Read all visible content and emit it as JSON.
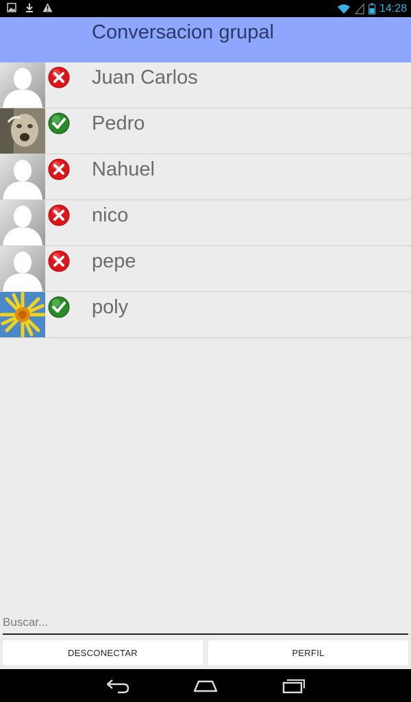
{
  "status_bar": {
    "time": "14:28",
    "icons": [
      "image-notification-icon",
      "download-icon",
      "warning-icon",
      "wifi-icon",
      "signal-icon",
      "battery-icon"
    ]
  },
  "header": {
    "title": "Conversacion grupal"
  },
  "contacts": [
    {
      "name": "Juan Carlos",
      "status": "offline",
      "avatar": "default-avatar"
    },
    {
      "name": "Pedro",
      "status": "online",
      "avatar": "photo-face"
    },
    {
      "name": "Nahuel",
      "status": "offline",
      "avatar": "default-avatar"
    },
    {
      "name": "nico",
      "status": "offline",
      "avatar": "default-avatar"
    },
    {
      "name": "pepe",
      "status": "offline",
      "avatar": "default-avatar"
    },
    {
      "name": "poly",
      "status": "online",
      "avatar": "photo-flower"
    }
  ],
  "search": {
    "placeholder": "Buscar...",
    "value": ""
  },
  "buttons": {
    "disconnect": "DESCONECTAR",
    "profile": "PERFIL"
  },
  "colors": {
    "header_bg": "#8fa6ff",
    "online": "#2a8a2a",
    "offline": "#e0151b",
    "time": "#33b5e5"
  }
}
